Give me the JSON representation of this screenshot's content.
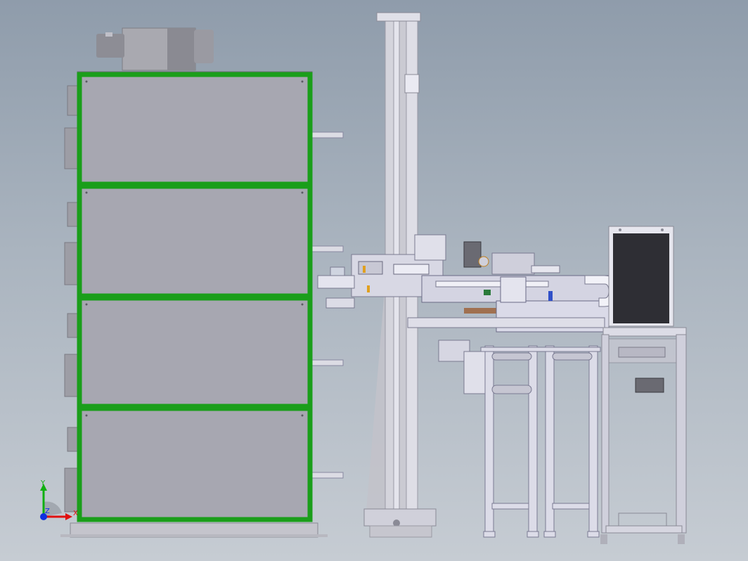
{
  "viewport": {
    "background_top": "#8f9cab",
    "background_bottom": "#c6ccd3",
    "highlight_color": "#1a9e1a"
  },
  "triad": {
    "x_label": "X",
    "y_label": "Y",
    "z_label": "Z",
    "x_color": "#e01010",
    "y_color": "#10b010",
    "z_color": "#1030e0"
  }
}
